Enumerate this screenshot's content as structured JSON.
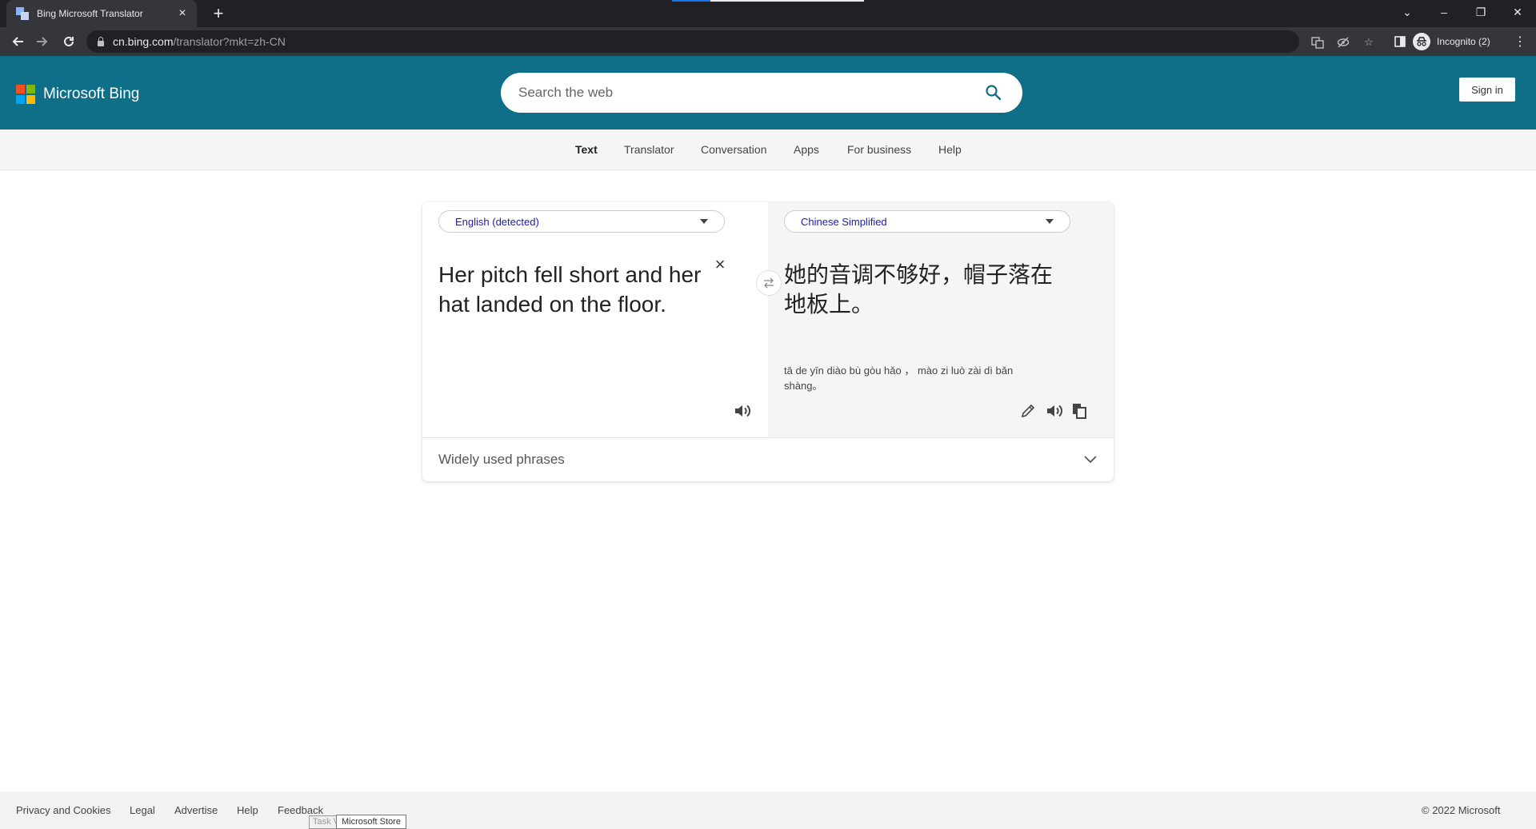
{
  "browser": {
    "tab_title": "Bing Microsoft Translator",
    "new_tab_symbol": "+",
    "url_host": "cn.bing.com",
    "url_path": "/translator?mkt=zh-CN",
    "profile_label": "Incognito (2)",
    "colors": {
      "tabstrip": "#202124",
      "toolbar": "#35363a",
      "text": "#e8eaed"
    }
  },
  "bing": {
    "brand": "Microsoft Bing",
    "search_placeholder": "Search the web",
    "sign_in": "Sign in",
    "header_color": "#0f6f88"
  },
  "subnav": {
    "items": [
      "Text",
      "Translator",
      "Conversation",
      "Apps",
      "For business",
      "Help"
    ],
    "active": "Text"
  },
  "translator": {
    "source_language": "English (detected)",
    "target_language": "Chinese Simplified",
    "source_text": "Her pitch fell short and her hat landed on the floor.",
    "translated_text": "她的音调不够好，帽子落在地板上。",
    "pinyin": "tā de yīn diào bù gòu hǎo ， mào zi luò zài dì bǎn shàng。",
    "phrases_label": "Widely used phrases",
    "language_color": "#1c1ca8"
  },
  "footer": {
    "links": [
      "Privacy and Cookies",
      "Legal",
      "Advertise",
      "Help",
      "Feedback"
    ],
    "copyright": "© 2022 Microsoft"
  },
  "tooltips": {
    "taskview": "Task View",
    "store": "Microsoft Store"
  },
  "icons": [
    "tab-favicon",
    "close-icon",
    "back-icon",
    "forward-icon",
    "reload-icon",
    "lock-icon",
    "translate-page-icon",
    "eye-off-icon",
    "star-icon",
    "side-panel-icon",
    "incognito-icon",
    "menu-icon",
    "search-icon",
    "clear-icon",
    "swap-icon",
    "speaker-icon",
    "edit-icon",
    "copy-icon",
    "chevron-down-icon"
  ]
}
